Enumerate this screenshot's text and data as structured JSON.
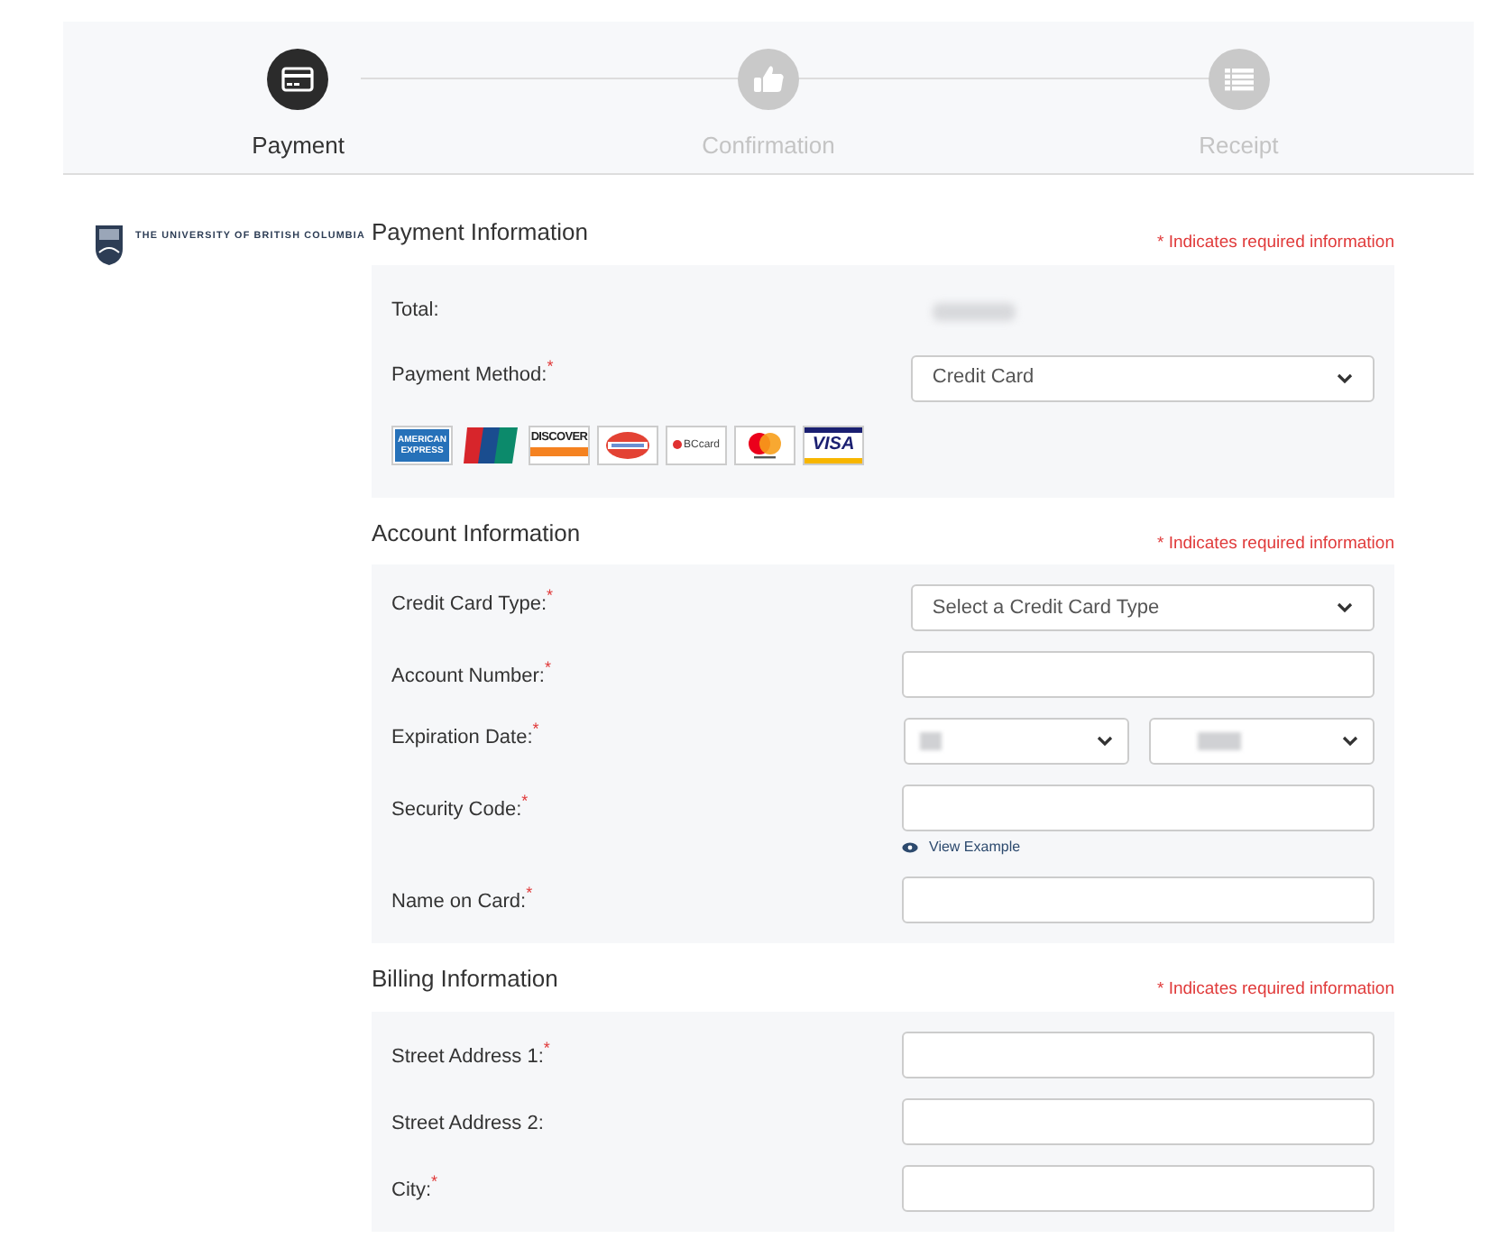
{
  "steps": [
    {
      "label": "Payment",
      "kind": "card",
      "selected": true
    },
    {
      "label": "Confirmation",
      "kind": "thumb",
      "selected": false
    },
    {
      "label": "Receipt",
      "kind": "list",
      "selected": false
    }
  ],
  "logo": {
    "name": "THE UNIVERSITY OF BRITISH COLUMBIA"
  },
  "sections": [
    {
      "title": "Payment Information",
      "note": "* Indicates required information",
      "rows": [
        {
          "kind": "hidden-value",
          "label": "Total:"
        },
        {
          "kind": "select",
          "label": "Payment Method:",
          "required_mark": "*",
          "value": "Credit Card"
        },
        {
          "kind": "cards",
          "cards": [
            {
              "kind": "amex",
              "label": "AMERICAN EXPRESS"
            },
            {
              "kind": "unionpay"
            },
            {
              "kind": "discover",
              "label": "DISCOVER"
            },
            {
              "kind": "diners"
            },
            {
              "kind": "bccard",
              "label": "BCcard"
            },
            {
              "kind": "mastercard"
            },
            {
              "kind": "visa",
              "label": "VISA"
            }
          ]
        }
      ]
    },
    {
      "title": "Account Information",
      "note": "* Indicates required information",
      "rows": [
        {
          "kind": "select",
          "label": "Credit Card Type:",
          "required_mark": "*",
          "value": "Select a Credit Card Type"
        },
        {
          "kind": "input",
          "label": "Account Number:",
          "required_mark": "*"
        },
        {
          "kind": "date",
          "label": "Expiration Date:",
          "required_mark": "*"
        },
        {
          "kind": "input",
          "label": "Security Code:",
          "required_mark": "*",
          "link": "View Example"
        },
        {
          "kind": "input",
          "label": "Name on Card:",
          "required_mark": "*"
        }
      ]
    },
    {
      "title": "Billing Information",
      "note": "* Indicates required information",
      "rows": [
        {
          "kind": "input",
          "label": "Street Address 1:",
          "required_mark": "*"
        },
        {
          "kind": "input",
          "label": "Street Address 2:"
        },
        {
          "kind": "input",
          "label": "City:",
          "required_mark": "*"
        }
      ]
    }
  ]
}
